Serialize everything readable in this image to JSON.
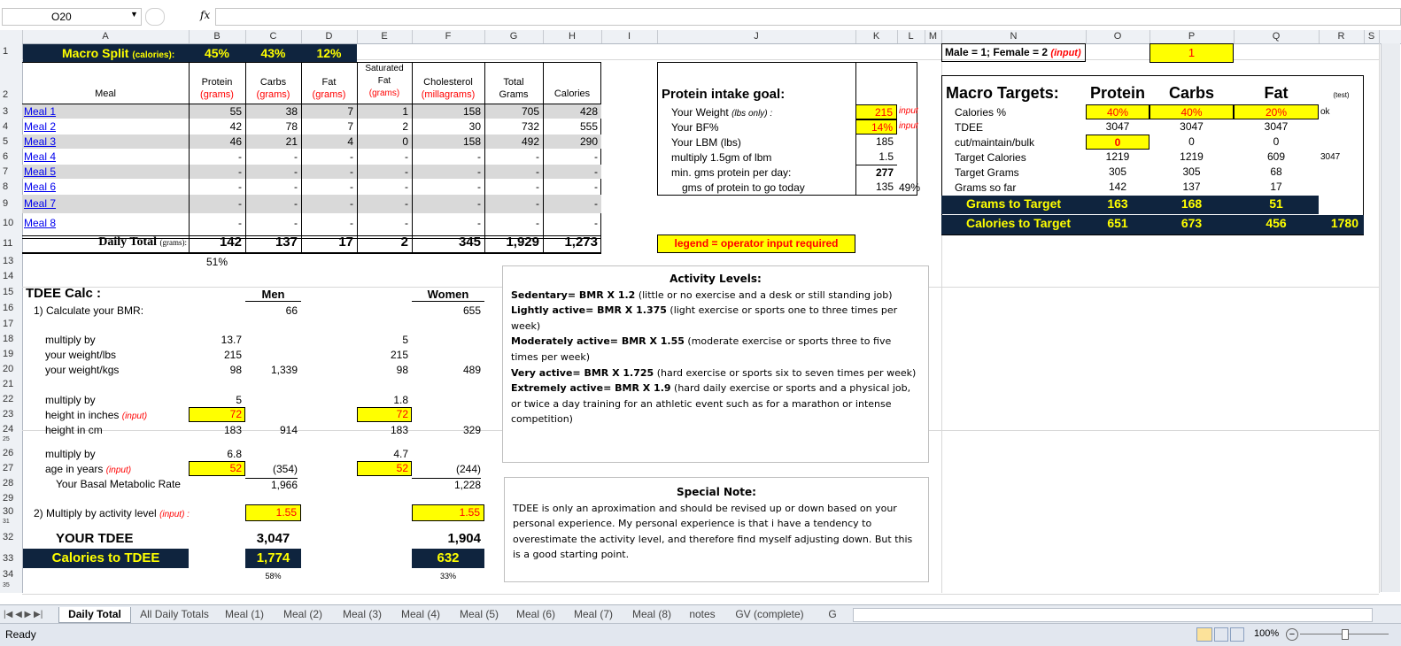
{
  "formula_bar": {
    "name_box": "O20",
    "fx": "fx",
    "value": ""
  },
  "columns": [
    "A",
    "B",
    "C",
    "D",
    "E",
    "F",
    "G",
    "H",
    "I",
    "J",
    "K",
    "L",
    "M",
    "N",
    "O",
    "P",
    "Q",
    "R",
    "S"
  ],
  "rows": [
    "1",
    "2",
    "3",
    "4",
    "5",
    "6",
    "7",
    "8",
    "9",
    "10",
    "11",
    "13",
    "14",
    "15",
    "16",
    "17",
    "18",
    "19",
    "20",
    "21",
    "22",
    "23",
    "24",
    "25",
    "26",
    "27",
    "28",
    "29",
    "30",
    "31",
    "32",
    "33",
    "34",
    "35"
  ],
  "macro_split": {
    "label": "Macro Split",
    "label_small": "(calories):",
    "protein": "45%",
    "carbs": "43%",
    "fat": "12%"
  },
  "meal_headers": {
    "meal": "Meal",
    "protein": "Protein",
    "protein_u": "(grams)",
    "carbs": "Carbs",
    "carbs_u": "(grams)",
    "fat": "Fat",
    "fat_u": "(grams)",
    "sat1": "Saturated",
    "sat2": "Fat",
    "sat_u": "(grams)",
    "chol": "Cholesterol",
    "chol_u": "(millagrams)",
    "total1": "Total",
    "total2": "Grams",
    "cal": "Calories"
  },
  "meals": [
    {
      "name": "Meal 1",
      "protein": "55",
      "carbs": "38",
      "fat": "7",
      "sat": "1",
      "chol": "158",
      "total": "705",
      "cal": "428"
    },
    {
      "name": "Meal 2",
      "protein": "42",
      "carbs": "78",
      "fat": "7",
      "sat": "2",
      "chol": "30",
      "total": "732",
      "cal": "555"
    },
    {
      "name": "Meal 3",
      "protein": "46",
      "carbs": "21",
      "fat": "4",
      "sat": "0",
      "chol": "158",
      "total": "492",
      "cal": "290"
    },
    {
      "name": "Meal 4",
      "protein": "-",
      "carbs": "-",
      "fat": "-",
      "sat": "-",
      "chol": "-",
      "total": "-",
      "cal": "-"
    },
    {
      "name": "Meal 5",
      "protein": "-",
      "carbs": "-",
      "fat": "-",
      "sat": "-",
      "chol": "-",
      "total": "-",
      "cal": "-"
    },
    {
      "name": "Meal 6",
      "protein": "-",
      "carbs": "-",
      "fat": "-",
      "sat": "-",
      "chol": "-",
      "total": "-",
      "cal": "-"
    },
    {
      "name": "Meal 7",
      "protein": "-",
      "carbs": "-",
      "fat": "-",
      "sat": "-",
      "chol": "-",
      "total": "-",
      "cal": "-"
    },
    {
      "name": "Meal 8",
      "protein": "-",
      "carbs": "-",
      "fat": "-",
      "sat": "-",
      "chol": "-",
      "total": "-",
      "cal": "-"
    }
  ],
  "daily_total": {
    "label": "Daily Total",
    "label_small": "(grams):",
    "protein": "142",
    "carbs": "137",
    "fat": "17",
    "sat": "2",
    "chol": "345",
    "total": "1,929",
    "cal": "1,273",
    "pct": "51%"
  },
  "protein_goal": {
    "title": "Protein intake goal:",
    "rows": [
      {
        "label": "Your Weight",
        "label_small": "(lbs only) :",
        "value": "215",
        "note": "input",
        "input": true
      },
      {
        "label": "Your BF%",
        "label_small": "",
        "value": "14%",
        "note": "input",
        "input": true
      },
      {
        "label": "Your LBM (lbs)",
        "label_small": "",
        "value": "185",
        "note": "",
        "input": false
      },
      {
        "label": "multiply 1.5gm of lbm",
        "label_small": "",
        "value": "1.5",
        "note": "",
        "input": false
      },
      {
        "label": "min. gms protein per day:",
        "label_small": "",
        "value": "277",
        "note": "",
        "input": false
      },
      {
        "label": "gms of protein to go today",
        "label_small": "",
        "value": "135",
        "note": "49%",
        "input": false
      }
    ]
  },
  "legend": "legend = operator input required",
  "gender": {
    "label": "Male = 1; Female = 2",
    "input_label": "(input)",
    "value": "1"
  },
  "macro_targets": {
    "title": "Macro Targets:",
    "protein": "Protein",
    "carbs": "Carbs",
    "fat": "Fat",
    "test": "(test)",
    "rows": [
      {
        "label": "Calories %",
        "protein": "40%",
        "carbs": "40%",
        "fat": "20%",
        "extra": "ok"
      },
      {
        "label": "TDEE",
        "protein": "3047",
        "carbs": "3047",
        "fat": "3047",
        "extra": ""
      },
      {
        "label": "cut/maintain/bulk",
        "protein": "0",
        "carbs": "0",
        "fat": "0",
        "extra": ""
      },
      {
        "label": "Target Calories",
        "protein": "1219",
        "carbs": "1219",
        "fat": "609",
        "extra": "3047"
      },
      {
        "label": "Target Grams",
        "protein": "305",
        "carbs": "305",
        "fat": "68",
        "extra": ""
      },
      {
        "label": "Grams so far",
        "protein": "142",
        "carbs": "137",
        "fat": "17",
        "extra": ""
      }
    ],
    "grams_to_target": {
      "label": "Grams to Target",
      "protein": "163",
      "carbs": "168",
      "fat": "51"
    },
    "calories_to_target": {
      "label": "Calories to Target",
      "protein": "651",
      "carbs": "673",
      "fat": "456",
      "total": "1780"
    }
  },
  "tdee": {
    "title": "TDEE Calc :",
    "men": "Men",
    "women": "Women",
    "step1": "1) Calculate your BMR:",
    "men_base": "66",
    "women_base": "655",
    "mult_by": "multiply by",
    "weight_lbs": "your weight/lbs",
    "weight_kgs": "your weight/kgs",
    "m_w1": "13.7",
    "m_w2": "215",
    "m_w3": "98",
    "m_w_res": "1,339",
    "f_w1": "5",
    "f_w2": "215",
    "f_w3": "98",
    "f_w_res": "489",
    "height_in": "height in inches",
    "height_cm": "height in cm",
    "input_tag": "(input)",
    "m_h1": "5",
    "m_h2": "72",
    "m_h3": "183",
    "m_h_res": "914",
    "f_h1": "1.8",
    "f_h2": "72",
    "f_h3": "183",
    "f_h_res": "329",
    "age": "age in years",
    "m_a1": "6.8",
    "m_a2": "52",
    "m_a_res": "(354)",
    "f_a1": "4.7",
    "f_a2": "52",
    "f_a_res": "(244)",
    "bmr_label": "Your Basal Metabolic Rate",
    "m_bmr": "1,966",
    "f_bmr": "1,228",
    "step2": "2) Multiply by activity level",
    "step2_input": "(input) :",
    "m_act": "1.55",
    "f_act": "1.55",
    "your_tdee": "YOUR TDEE",
    "m_tdee": "3,047",
    "f_tdee": "1,904",
    "cal_to_tdee": "Calories to TDEE",
    "m_cal": "1,774",
    "f_cal": "632",
    "m_pct": "58%",
    "f_pct": "33%"
  },
  "activity": {
    "title": "Activity Levels:",
    "items": [
      {
        "name": "Sedentary",
        "formula": "= BMR X 1.2",
        "desc": "(little or no exercise and a desk or still standing job)"
      },
      {
        "name": "Lightly active",
        "formula": "= BMR X 1.375",
        "desc": "(light exercise or sports one to three times per week)"
      },
      {
        "name": "Moderately active",
        "formula": "= BMR X 1.55",
        "desc": "(moderate exercise or sports three to five times per week)"
      },
      {
        "name": "Very active",
        "formula": "= BMR X 1.725",
        "desc": "(hard exercise or sports six to seven times per week)"
      },
      {
        "name": "Extremely active",
        "formula": "= BMR X 1.9",
        "desc": "(hard daily exercise or sports and a physical job, or twice a day training for an athletic event such as for a marathon or intense competition)"
      }
    ]
  },
  "note": {
    "title": "Special Note:",
    "text": "TDEE is only an aproximation and should be revised up or down based on your personal experience.  My personal experience is that i have a tendency to overestimate the activity level, and therefore find myself adjusting down.  But this is a good starting point."
  },
  "tabs": [
    "Daily Total",
    "All Daily Totals",
    "Meal (1)",
    "Meal (2)",
    "Meal (3)",
    "Meal (4)",
    "Meal (5)",
    "Meal (6)",
    "Meal (7)",
    "Meal (8)",
    "notes",
    "GV (complete)",
    "G"
  ],
  "status": {
    "ready": "Ready",
    "zoom": "100%"
  }
}
